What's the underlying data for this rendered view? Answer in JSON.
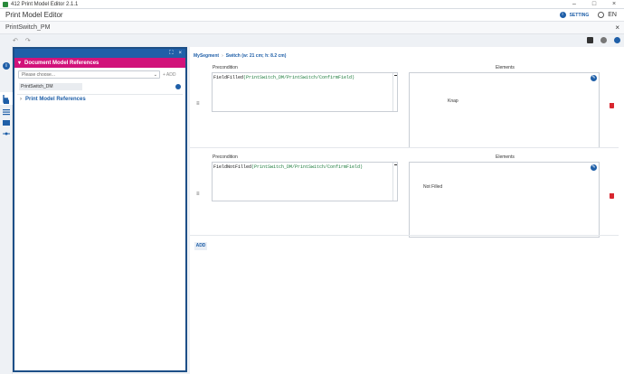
{
  "window": {
    "title": "412 Print Model Editor 2.1.1"
  },
  "appbar": {
    "title": "Print Model Editor",
    "setting_label": "SETTING",
    "language": "EN"
  },
  "document_tab": {
    "name": "PrintSwitch_PM"
  },
  "side_panel": {
    "header": "Document Model References",
    "select": {
      "placeholder": "Please choose..."
    },
    "add_label": "ADD",
    "references": [
      {
        "label": "PrintSwitch_DM"
      }
    ],
    "print_model_references": "Print Model References"
  },
  "breadcrumb": {
    "segment": "MySegment",
    "detail": "Switch (w: 21 cm; h: 8.2 cm)"
  },
  "segments": [
    {
      "precondition_label": "Precondition",
      "elements_label": "Elements",
      "precondition_fn": "FieldFilled",
      "precondition_arg": "(PrintSwitch_DM/PrintSwitch/ConfirmField)",
      "element_text": "Knap"
    },
    {
      "precondition_label": "Precondition",
      "elements_label": "Elements",
      "precondition_fn": "FieldNotFilled",
      "precondition_arg": "(PrintSwitch_DM/PrintSwitch/ConfirmField)",
      "element_text": "Not Filled"
    }
  ],
  "main": {
    "add_label": "ADD"
  },
  "colors": {
    "primary": "#1f5fa8",
    "accent": "#d1127a",
    "danger": "#d8262f"
  }
}
